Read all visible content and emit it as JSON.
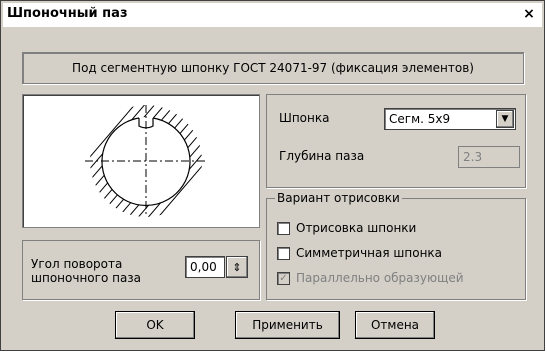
{
  "window": {
    "title": "Шпоночный паз",
    "close_glyph": "×"
  },
  "header": {
    "text": "Под сегментную шпонку ГОСТ 24071-97 (фиксация элементов)"
  },
  "angle": {
    "label": "Угол поворота шпоночного паза",
    "value": "0,00"
  },
  "key": {
    "label": "Шпонка",
    "selected": "Сегм. 5x9",
    "depth_label": "Глубина паза",
    "depth_value": "2.3"
  },
  "variant": {
    "title": "Вариант отрисовки",
    "options": [
      {
        "label": "Отрисовка шпонки",
        "checked": false,
        "enabled": true
      },
      {
        "label": "Симметричная шпонка",
        "checked": false,
        "enabled": true
      },
      {
        "label": "Параллельно образующей",
        "checked": true,
        "enabled": false
      }
    ]
  },
  "buttons": {
    "ok": "OK",
    "apply": "Применить",
    "cancel": "Отмена"
  }
}
